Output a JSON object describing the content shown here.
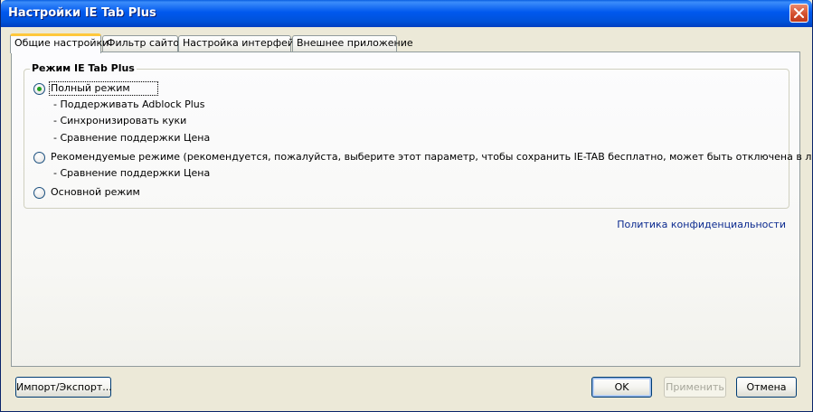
{
  "window": {
    "title": "Настройки IE Tab Plus"
  },
  "tabs": [
    {
      "label": "Общие настройки"
    },
    {
      "label": "Фильтр сайтов"
    },
    {
      "label": "Настройка интерфейса"
    },
    {
      "label": "Внешнее приложение"
    }
  ],
  "group": {
    "title": "Режим IE Tab Plus",
    "options": [
      {
        "label": "Полный режим",
        "checked": true
      },
      {
        "label": "Рекомендуемые режиме (рекомендуется, пожалуйста, выберите этот параметр, чтобы сохранить IE-TAB бесплатно, может быть отключена в любое время)",
        "checked": false
      },
      {
        "label": "Основной режим",
        "checked": false
      }
    ],
    "full_mode_features": [
      "- Поддерживать Adblock Plus",
      "- Синхронизировать куки",
      "- Сравнение поддержки Цена"
    ],
    "recommended_mode_features": [
      "- Сравнение поддержки Цена"
    ]
  },
  "privacy_link": "Политика конфиденциальности",
  "buttons": {
    "import_export": "Импорт/Экспорт...",
    "ok": "OK",
    "apply": "Применить",
    "cancel": "Отмена"
  }
}
